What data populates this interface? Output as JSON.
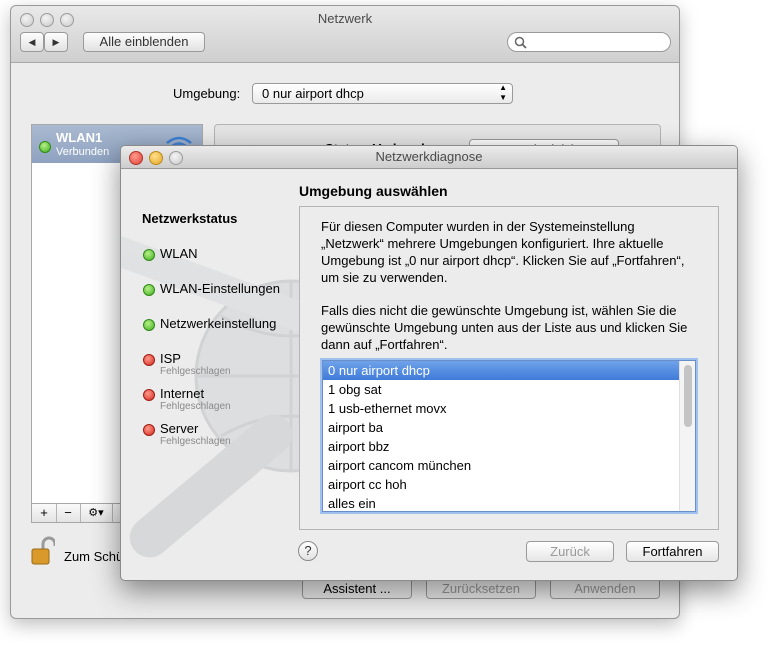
{
  "back_window": {
    "title": "Netzwerk",
    "toolbar": {
      "show_all_label": "Alle einblenden",
      "nav_back": "◀",
      "nav_fwd": "▶"
    },
    "location": {
      "label": "Umgebung:",
      "value": "0 nur airport dhcp"
    },
    "sidebar": {
      "selected": {
        "name": "WLAN1",
        "status": "Verbunden"
      },
      "add": "+",
      "remove": "−",
      "gear": "⚙▾"
    },
    "status_row": {
      "label": "Status: Verbunden",
      "button": "WLAN deaktivieren"
    },
    "lock_label": "Zum Schützen hier klicken",
    "buttons": {
      "assistant": "Assistent ...",
      "reset": "Zurücksetzen",
      "apply": "Anwenden"
    }
  },
  "dialog": {
    "title": "Netzwerkdiagnose",
    "heading": "Umgebung auswählen",
    "status_title": "Netzwerkstatus",
    "status_items": [
      {
        "label": "WLAN",
        "sub": "",
        "state": "ok"
      },
      {
        "label": "WLAN-Einstellungen",
        "sub": "",
        "state": "ok"
      },
      {
        "label": "Netzwerkeinstellung",
        "sub": "",
        "state": "ok"
      },
      {
        "label": "ISP",
        "sub": "Fehlgeschlagen",
        "state": "fail"
      },
      {
        "label": "Internet",
        "sub": "Fehlgeschlagen",
        "state": "fail"
      },
      {
        "label": "Server",
        "sub": "Fehlgeschlagen",
        "state": "fail"
      }
    ],
    "paragraph1": "Für diesen Computer wurden in der Systemeinstellung „Netzwerk“ mehrere Umgebungen konfiguriert. Ihre aktuelle Umgebung ist „0 nur airport dhcp“. Klicken Sie auf „Fortfahren“, um sie zu verwenden.",
    "paragraph2": "Falls dies nicht die gewünschte Umgebung ist, wählen Sie die gewünschte Umgebung unten aus der Liste aus und klicken Sie dann auf „Fortfahren“.",
    "locations": [
      "0 nur airport dhcp",
      "1 obg sat",
      "1 usb-ethernet movx",
      "airport ba",
      "airport bbz",
      "airport cancom münchen",
      "airport cc hoh",
      "alles ein"
    ],
    "selected_index": 0,
    "help": "?",
    "back_button": "Zurück",
    "continue_button": "Fortfahren"
  }
}
